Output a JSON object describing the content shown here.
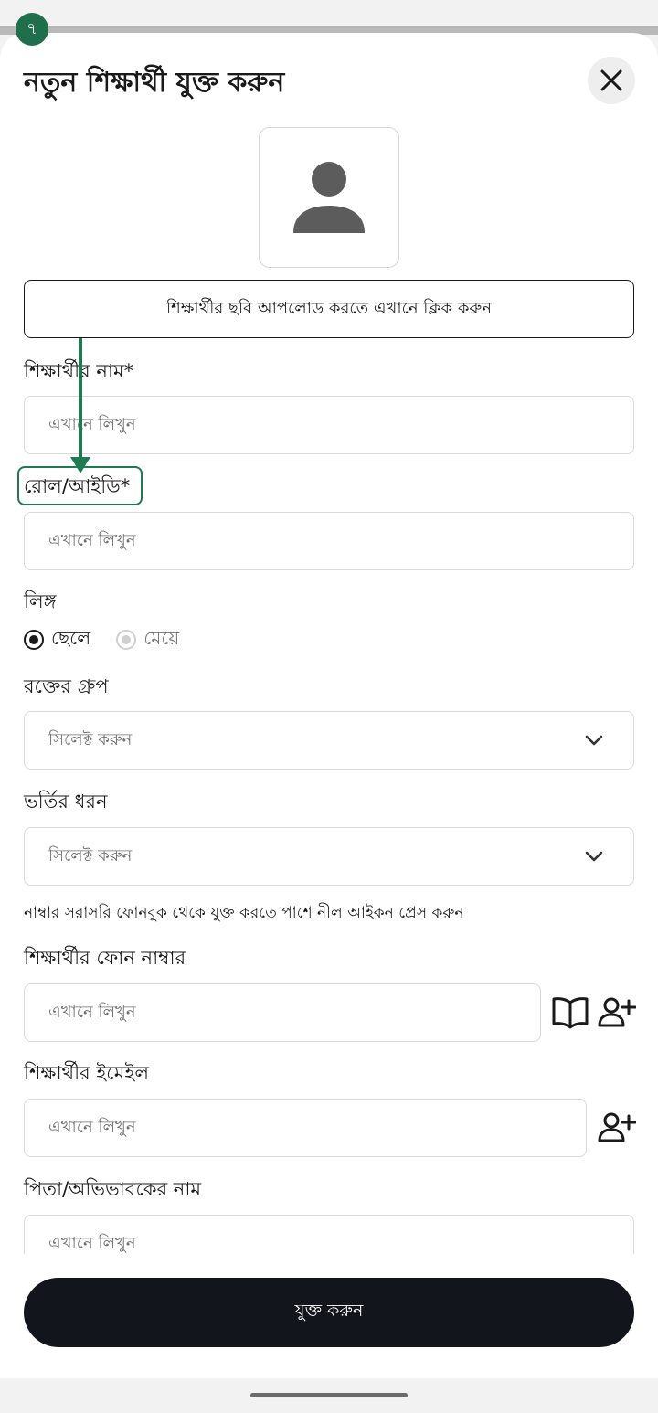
{
  "step_badge": "৭",
  "title": "নতুন শিক্ষার্থী যুক্ত করুন",
  "upload_label": "শিক্ষার্থীর ছবি আপলোড করতে এখানে ক্লিক করুন",
  "fields": {
    "name": {
      "label": "শিক্ষার্থীর নাম*",
      "placeholder": "এখানে লিখুন"
    },
    "roll": {
      "label": "রোল/আইডি*",
      "placeholder": "এখানে লিখুন"
    },
    "gender": {
      "label": "লিঙ্গ",
      "options": [
        "ছেলে",
        "মেয়ে"
      ],
      "selected": "ছেলে"
    },
    "blood_group": {
      "label": "রক্তের গ্রুপ",
      "placeholder": "সিলেক্ট করুন"
    },
    "admission_type": {
      "label": "ভর্তির ধরন",
      "placeholder": "সিলেক্ট করুন"
    },
    "phone_hint": "নাম্বার সরাসরি ফোনবুক থেকে যুক্ত করতে পাশে নীল আইকন প্রেস করুন",
    "phone": {
      "label": "শিক্ষার্থীর ফোন নাম্বার",
      "placeholder": "এখানে লিখুন"
    },
    "email": {
      "label": "শিক্ষার্থীর ইমেইল",
      "placeholder": "এখানে লিখুন"
    },
    "guardian": {
      "label": "পিতা/অভিভাবকের নাম",
      "placeholder": "এখানে লিখুন"
    }
  },
  "submit_label": "যুক্ত করুন",
  "colors": {
    "accent": "#1f7a52",
    "button_dark": "#12151b"
  }
}
